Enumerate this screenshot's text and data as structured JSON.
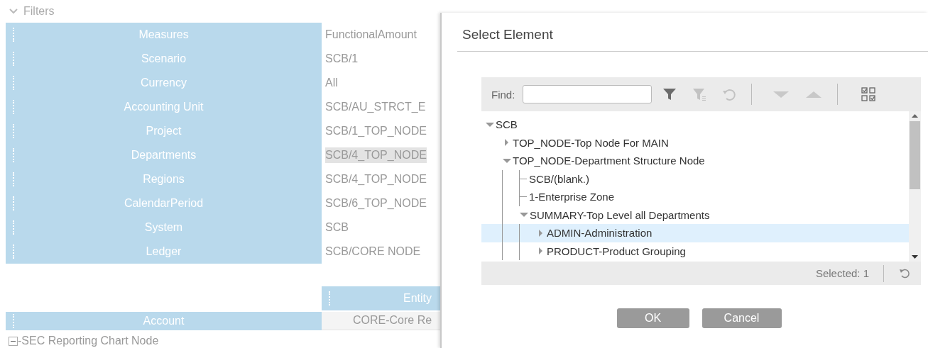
{
  "filters_header": {
    "label": "Filters",
    "expanded": true
  },
  "filters": [
    {
      "label": "Measures",
      "value": "FunctionalAmount",
      "selected": false
    },
    {
      "label": "Scenario",
      "value": "SCB/1",
      "selected": false
    },
    {
      "label": "Currency",
      "value": "All",
      "selected": false
    },
    {
      "label": "Accounting Unit",
      "value": "SCB/AU_STRCT_E",
      "selected": false
    },
    {
      "label": "Project",
      "value": "SCB/1_TOP_NODE",
      "selected": false
    },
    {
      "label": "Departments",
      "value": "SCB/4_TOP_NODE",
      "selected": true
    },
    {
      "label": "Regions",
      "value": "SCB/4_TOP_NODE",
      "selected": false
    },
    {
      "label": "CalendarPeriod",
      "value": "SCB/6_TOP_NODE",
      "selected": false
    },
    {
      "label": "System",
      "value": "SCB",
      "selected": false
    },
    {
      "label": "Ledger",
      "value": "SCB/CORE NODE",
      "selected": false
    }
  ],
  "grid": {
    "column_header": "Entity",
    "row_header": "Account",
    "cell": "CORE-Core Re",
    "node": {
      "label": "-SEC Reporting Chart Node",
      "expanded": true
    }
  },
  "dialog": {
    "title": "Select Element",
    "find_label": "Find:",
    "tree": [
      {
        "label": "SCB",
        "kind": "node",
        "expanded": true,
        "selected": false,
        "children": [
          {
            "label": "TOP_NODE-Top Node For MAIN",
            "kind": "node",
            "expanded": false,
            "selected": false
          },
          {
            "label": "TOP_NODE-Department Structure Node",
            "kind": "node",
            "expanded": true,
            "selected": false,
            "children": [
              {
                "label": "SCB/(blank.)",
                "kind": "leaf",
                "selected": false
              },
              {
                "label": "1-Enterprise Zone",
                "kind": "leaf",
                "selected": false
              },
              {
                "label": "SUMMARY-Top Level all Departments",
                "kind": "node",
                "expanded": true,
                "selected": false,
                "children": [
                  {
                    "label": "ADMIN-Administration",
                    "kind": "node",
                    "expanded": false,
                    "selected": true
                  },
                  {
                    "label": "PRODUCT-Product Grouping",
                    "kind": "node",
                    "expanded": false,
                    "selected": false
                  }
                ]
              }
            ]
          }
        ]
      }
    ],
    "selected_count": "Selected: 1",
    "buttons": [
      "OK",
      "Cancel"
    ]
  }
}
